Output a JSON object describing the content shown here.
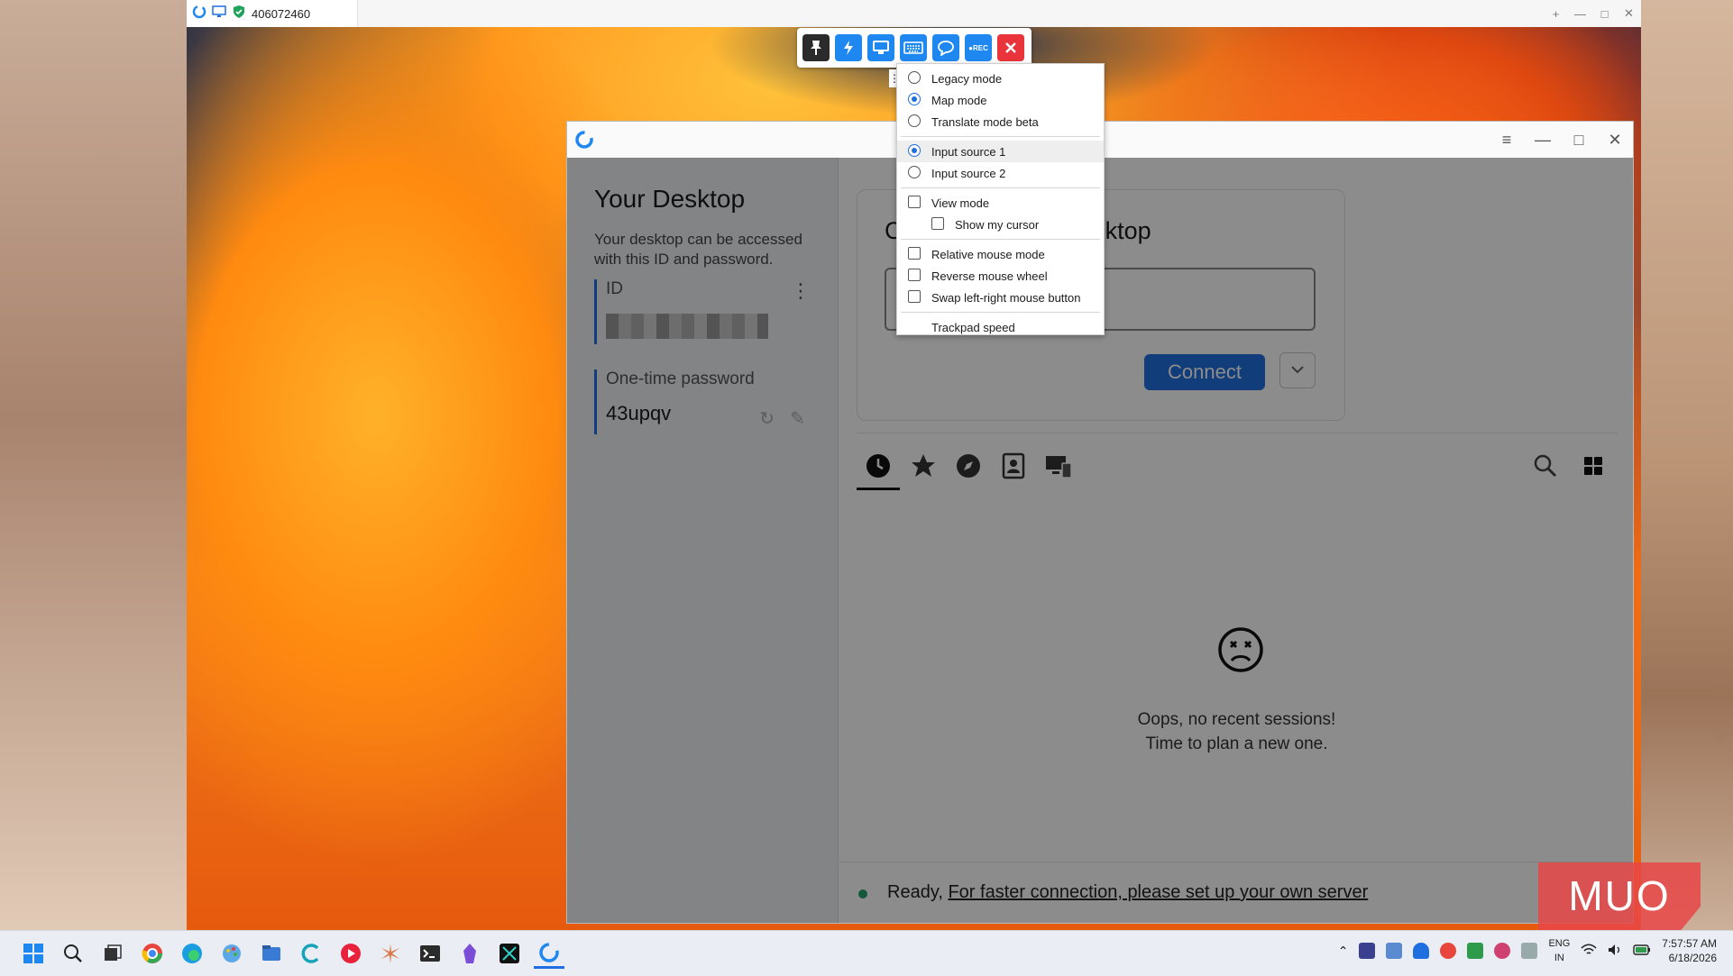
{
  "viewer": {
    "tab_id": "406072460",
    "controls": [
      "+",
      "—",
      "□",
      "✕"
    ]
  },
  "toolbar": {
    "buttons": [
      {
        "name": "pin",
        "glyph": "📌"
      },
      {
        "name": "action",
        "glyph": "⚡"
      },
      {
        "name": "display",
        "glyph": "🖥"
      },
      {
        "name": "keyboard",
        "glyph": "⌨"
      },
      {
        "name": "chat",
        "glyph": "💬"
      },
      {
        "name": "record",
        "glyph": "●REC"
      },
      {
        "name": "close",
        "glyph": "✕"
      }
    ]
  },
  "menu": {
    "legacy_mode": "Legacy mode",
    "map_mode": "Map mode",
    "translate_mode": "Translate mode beta",
    "input_source_1": "Input source 1",
    "input_source_2": "Input source 2",
    "view_mode": "View mode",
    "show_my_cursor": "Show my cursor",
    "relative_mouse_mode": "Relative mouse mode",
    "reverse_mouse_wheel": "Reverse mouse wheel",
    "swap_mouse_button": "Swap left-right mouse button",
    "trackpad_speed": "Trackpad speed"
  },
  "app": {
    "your_desktop_title": "Your Desktop",
    "your_desktop_desc": "Your desktop can be accessed with this ID and password.",
    "id_label": "ID",
    "otp_label": "One-time password",
    "otp_value": "43upqv",
    "control_title": "Control Remote Desktop",
    "remote_input_placeholder": "Enter remote ID",
    "connect_label": "Connect",
    "empty_line1": "Oops, no recent sessions!",
    "empty_line2": "Time to plan a new one.",
    "status_ready": "Ready,",
    "status_link": "For faster connection, please set up your own server"
  },
  "taskbar": {
    "lang_1": "ENG",
    "lang_2": "IN",
    "time": "7:57:57 AM",
    "date": "6/18/2026"
  },
  "watermark": "MUO"
}
